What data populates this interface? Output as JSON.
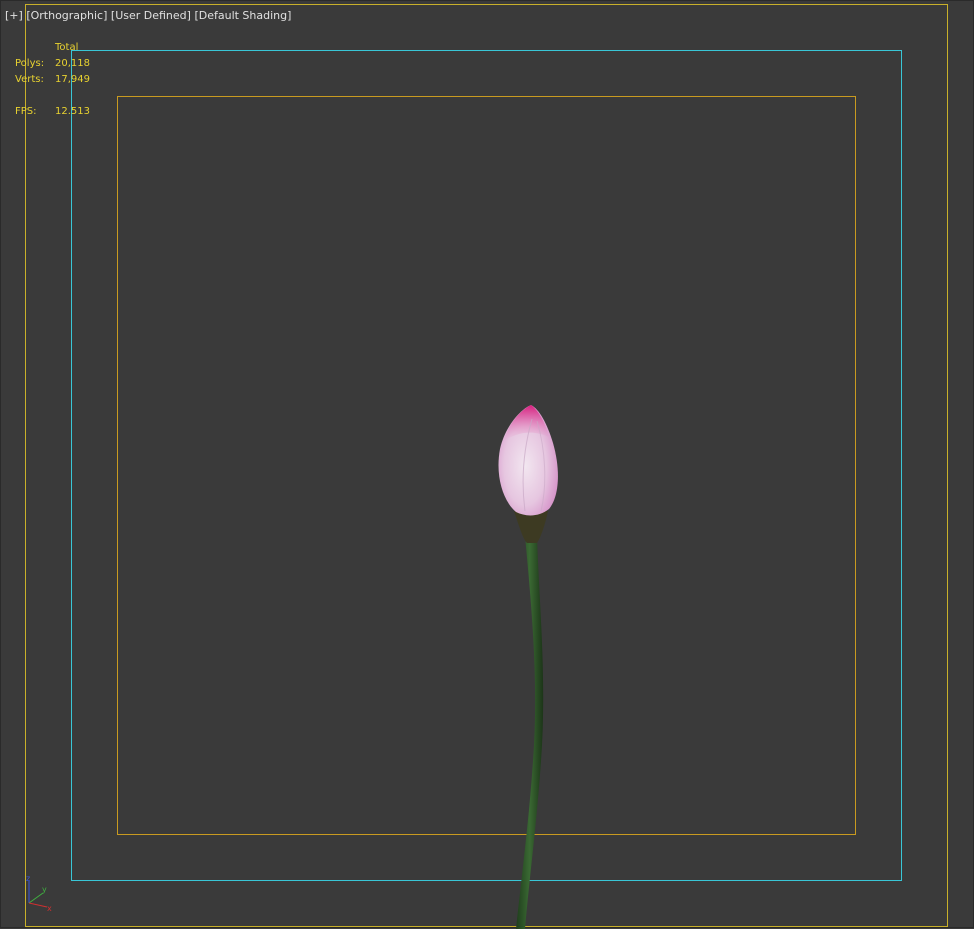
{
  "viewport": {
    "label": {
      "plus": "[+]",
      "view": "[Orthographic]",
      "camera": "[User Defined]",
      "shading": "[Default Shading]"
    },
    "stats": {
      "header": "Total",
      "polys_label": "Polys:",
      "polys_value": "20,118",
      "verts_label": "Verts:",
      "verts_value": "17,949",
      "fps_label": "FPS:",
      "fps_value": "12.513"
    },
    "axis_gizmo": {
      "z": "z",
      "y": "y",
      "x": "x"
    }
  },
  "colors": {
    "background": "#3a3a3a",
    "frame_outer": "#c8b02a",
    "frame_safe": "#39c6d6",
    "frame_title": "#c89a20",
    "stats_text": "#e8d230",
    "label_text": "#e0e0e0",
    "bud_pink": "#e060b0",
    "stem_green": "#2f5a2a"
  },
  "scene": {
    "object": "lotus-bud"
  }
}
